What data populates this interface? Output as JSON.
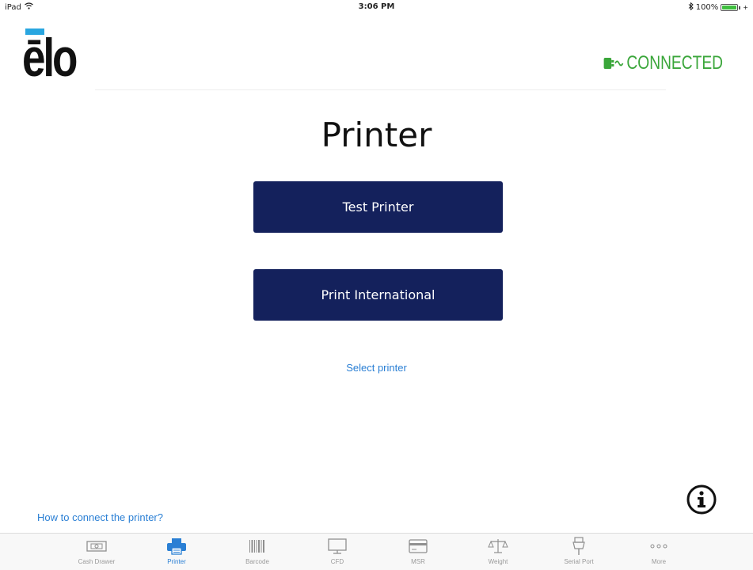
{
  "status_bar": {
    "device": "iPad",
    "time": "3:06 PM",
    "battery": "100%"
  },
  "header": {
    "logo_text": "ēlo",
    "connection_status": "CONNECTED",
    "connection_color": "#3aa63a"
  },
  "main": {
    "title": "Printer",
    "buttons": {
      "test_printer": "Test Printer",
      "print_international": "Print International"
    },
    "select_printer_link": "Select printer",
    "help_link": "How to connect the printer?",
    "button_color": "#14215c",
    "link_color": "#2a7fd4"
  },
  "tabs": [
    {
      "label": "Cash Drawer",
      "icon": "cash-drawer-icon",
      "active": false
    },
    {
      "label": "Printer",
      "icon": "printer-icon",
      "active": true
    },
    {
      "label": "Barcode",
      "icon": "barcode-icon",
      "active": false
    },
    {
      "label": "CFD",
      "icon": "monitor-icon",
      "active": false
    },
    {
      "label": "MSR",
      "icon": "card-icon",
      "active": false
    },
    {
      "label": "Weight",
      "icon": "scale-icon",
      "active": false
    },
    {
      "label": "Serial Port",
      "icon": "serial-port-icon",
      "active": false
    },
    {
      "label": "More",
      "icon": "more-icon",
      "active": false
    }
  ]
}
